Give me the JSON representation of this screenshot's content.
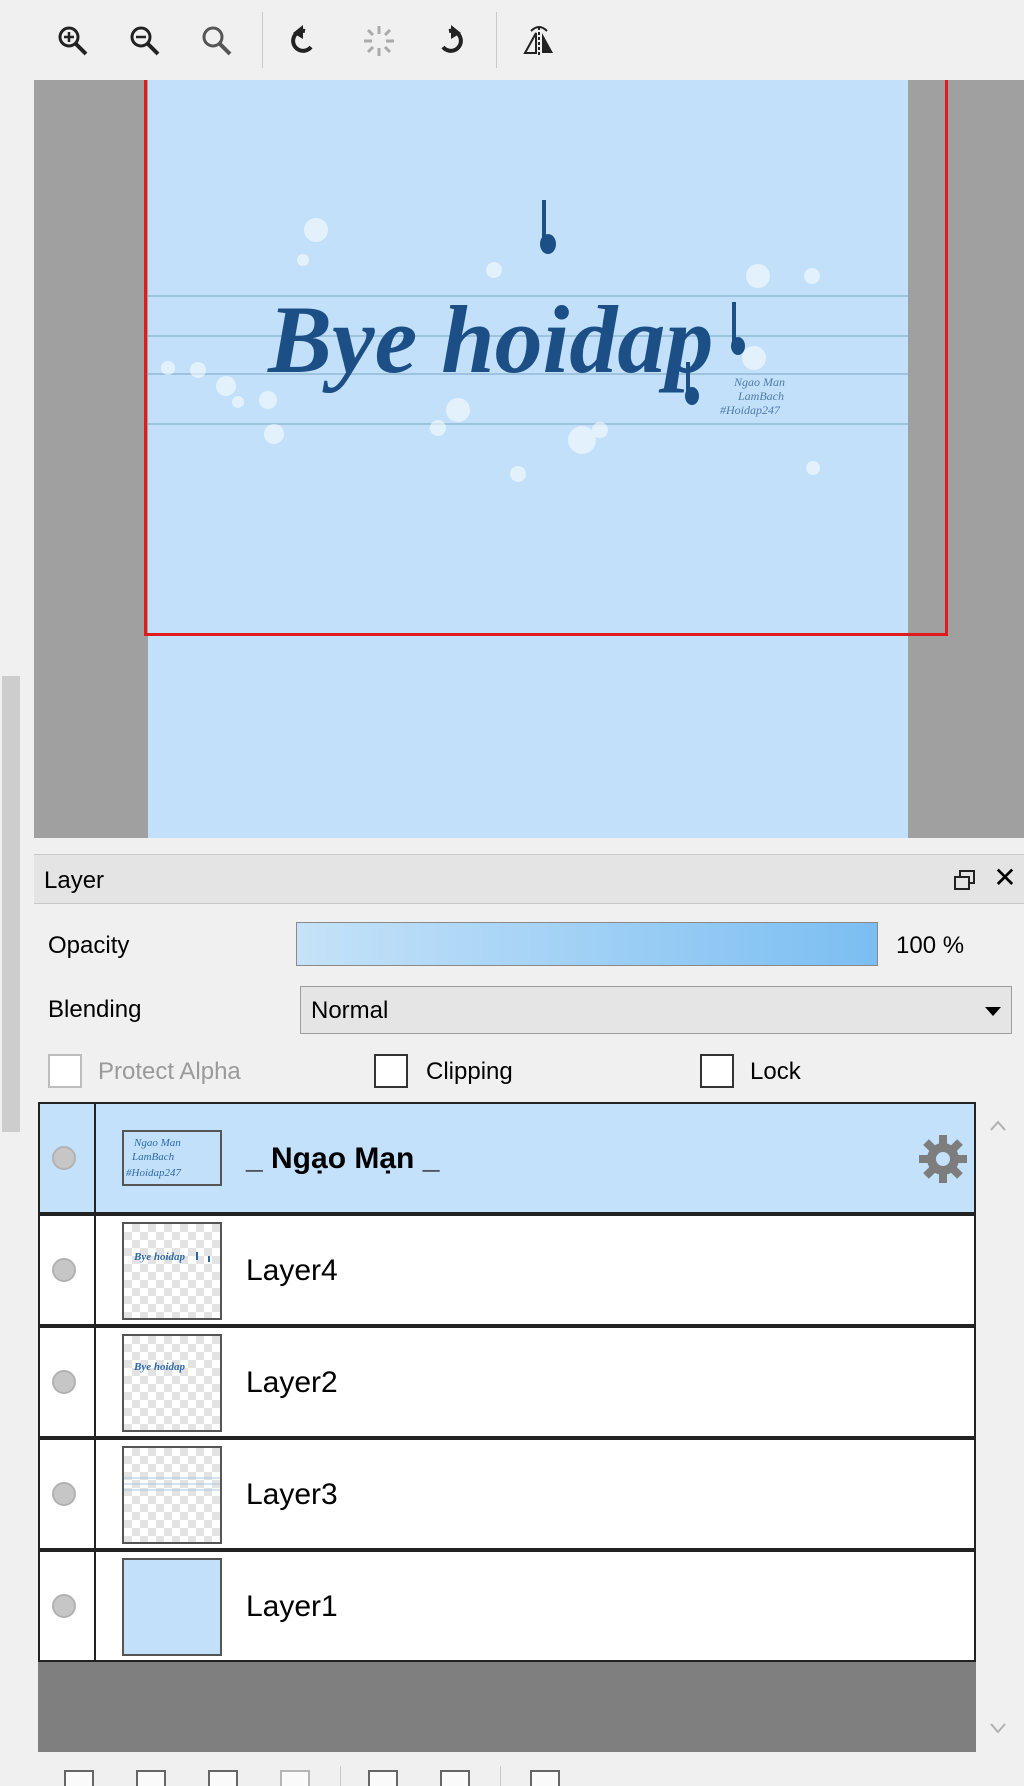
{
  "toolbar": {
    "buttons": [
      "zoom-in-icon",
      "zoom-out-icon",
      "zoom-reset-icon",
      "rotate-left-icon",
      "rotate-reset-icon",
      "rotate-right-icon",
      "flip-horizontal-icon"
    ]
  },
  "canvas": {
    "artwork_title": "Bye hoidap",
    "artwork_credit": [
      "Ngao Man",
      "LamBach",
      "#Hoidap247"
    ],
    "colors": {
      "artboard": "#c2e0fa",
      "frame": "#e01b1b",
      "ink": "#1c4f86"
    }
  },
  "layer_panel": {
    "title": "Layer",
    "opacity_label": "Opacity",
    "opacity_value": "100 %",
    "opacity_fraction": 1.0,
    "blending_label": "Blending",
    "blending_value": "Normal",
    "protect_alpha_label": "Protect Alpha",
    "clipping_label": "Clipping",
    "lock_label": "Lock",
    "layers": [
      {
        "name": "_ Ngạo Mạn _",
        "selected": true
      },
      {
        "name": "Layer4",
        "selected": false
      },
      {
        "name": "Layer2",
        "selected": false
      },
      {
        "name": "Layer3",
        "selected": false
      },
      {
        "name": "Layer1",
        "selected": false
      }
    ]
  }
}
